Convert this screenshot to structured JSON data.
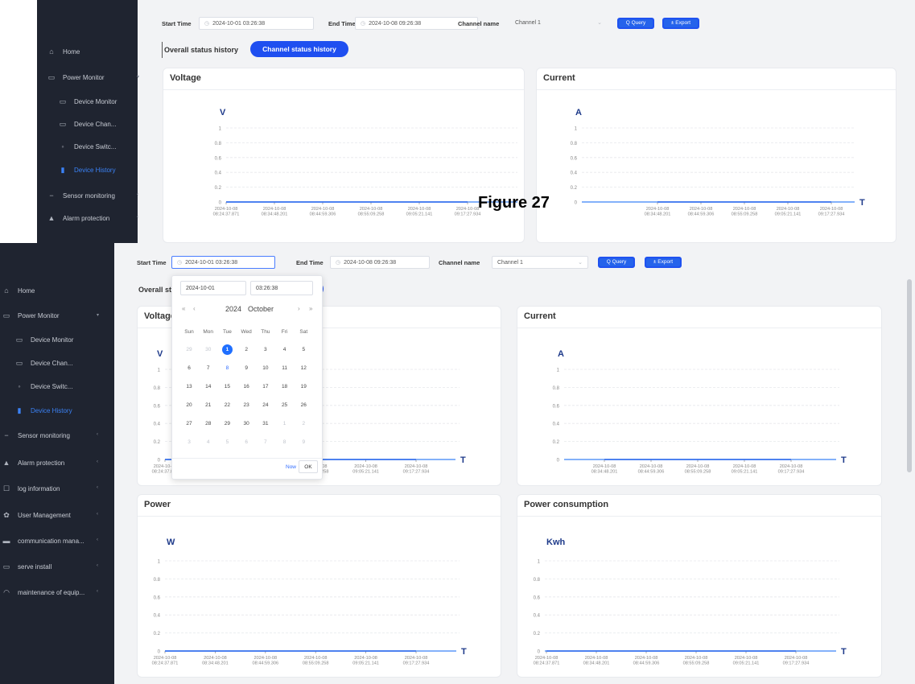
{
  "sidebar": {
    "items": [
      {
        "label": "Home",
        "icon": "home-icon"
      },
      {
        "label": "Power Monitor",
        "icon": "monitor-icon",
        "expanded": true
      },
      {
        "label": "Device Monitor",
        "icon": "monitor-icon"
      },
      {
        "label": "Device Chan...",
        "icon": "monitor-icon"
      },
      {
        "label": "Device Switc...",
        "icon": "switch-icon"
      },
      {
        "label": "Device History",
        "icon": "bar-chart-icon",
        "active": true
      },
      {
        "label": "Sensor monitoring",
        "icon": "sensor-icon"
      },
      {
        "label": "Alarm protection",
        "icon": "alarm-icon"
      },
      {
        "label": "log information",
        "icon": "log-icon"
      },
      {
        "label": "User Management",
        "icon": "gear-icon"
      },
      {
        "label": "communication mana...",
        "icon": "chat-icon"
      },
      {
        "label": "serve install",
        "icon": "monitor-icon"
      },
      {
        "label": "maintenance of equip...",
        "icon": "wifi-icon"
      }
    ],
    "accent": "#3b82f6"
  },
  "toolbar": {
    "start_label": "Start Time",
    "start_value": "2024-10-01 03:26:38",
    "end_label": "End Time",
    "end_value": "2024-10-08 09:26:38",
    "channel_label": "Channel name",
    "channel_value": "Channel 1",
    "query_label": "Q Query",
    "export_label": "± Export"
  },
  "tabs": {
    "overall": "Overall status history",
    "overall_cut": "Overall st",
    "channel": "Channel status history"
  },
  "figure_label": "Figure 27",
  "datepicker": {
    "date_value": "2024-10-01",
    "time_value": "03:26:38",
    "year": "2024",
    "month": "October",
    "nav_prev_year": "«",
    "nav_prev": "‹",
    "nav_next": "›",
    "nav_next_year": "»",
    "weekdays": [
      "Sun",
      "Mon",
      "Tue",
      "Wed",
      "Thu",
      "Fri",
      "Sat"
    ],
    "weeks": [
      [
        "29",
        "30",
        "1",
        "2",
        "3",
        "4",
        "5"
      ],
      [
        "6",
        "7",
        "8",
        "9",
        "10",
        "11",
        "12"
      ],
      [
        "13",
        "14",
        "15",
        "16",
        "17",
        "18",
        "19"
      ],
      [
        "20",
        "21",
        "22",
        "23",
        "24",
        "25",
        "26"
      ],
      [
        "27",
        "28",
        "29",
        "30",
        "31",
        "1",
        "2"
      ],
      [
        "3",
        "4",
        "5",
        "6",
        "7",
        "8",
        "9"
      ]
    ],
    "selected": "1",
    "today": "8",
    "now_label": "Now",
    "ok_label": "OK"
  },
  "chart_data": [
    {
      "type": "line",
      "title": "Voltage",
      "ylabel": "V",
      "xlabel": "T",
      "ylim": [
        0,
        1
      ],
      "yticks": [
        "1",
        "0.8",
        "0.6",
        "0.4",
        "0.2",
        "0"
      ],
      "x": [
        "2024-10-08 08:24:37.871",
        "2024-10-08 08:34:48.201",
        "2024-10-08 08:44:59.306",
        "2024-10-08 08:55:09.258",
        "2024-10-08 09:05:21.141",
        "2024-10-08 09:17:27.934"
      ],
      "values": [
        0,
        0,
        0,
        0,
        0,
        0
      ]
    },
    {
      "type": "line",
      "title": "Current",
      "ylabel": "A",
      "xlabel": "T",
      "ylim": [
        0,
        1
      ],
      "yticks": [
        "1",
        "0.8",
        "0.6",
        "0.4",
        "0.2",
        "0"
      ],
      "x": [
        "2024-10-08 08:34:48.201",
        "2024-10-08 08:44:59.306",
        "2024-10-08 08:55:09.258",
        "2024-10-08 09:05:21.141",
        "2024-10-08 09:17:27.934"
      ],
      "values": [
        0,
        0,
        0,
        0,
        0
      ]
    },
    {
      "type": "line",
      "title": "Power",
      "ylabel": "W",
      "xlabel": "T",
      "ylim": [
        0,
        1
      ],
      "yticks": [
        "1",
        "0.8",
        "0.6",
        "0.4",
        "0.2",
        "0"
      ],
      "x": [
        "2024-10-08 08:24:37.871",
        "2024-10-08 08:34:48.201",
        "2024-10-08 08:44:59.306",
        "2024-10-08 08:55:09.258",
        "2024-10-08 09:05:21.141",
        "2024-10-08 09:17:27.934"
      ],
      "values": [
        0,
        0,
        0,
        0,
        0,
        0
      ]
    },
    {
      "type": "line",
      "title": "Power consumption",
      "ylabel": "Kwh",
      "xlabel": "T",
      "ylim": [
        0,
        1
      ],
      "yticks": [
        "1",
        "0.8",
        "0.6",
        "0.4",
        "0.2",
        "0"
      ],
      "x": [
        "2024-10-08 08:24:37.871",
        "2024-10-08 08:34:48.201",
        "2024-10-08 08:44:59.306",
        "2024-10-08 08:55:09.258",
        "2024-10-08 09:05:21.141",
        "2024-10-08 09:17:27.934"
      ],
      "values": [
        0,
        0,
        0,
        0,
        0,
        0
      ]
    }
  ],
  "colors": {
    "primary": "#1f4ff0",
    "axis": "#3b82f6",
    "unit": "#1e3a8a",
    "sidebar_bg": "#1f2430"
  }
}
